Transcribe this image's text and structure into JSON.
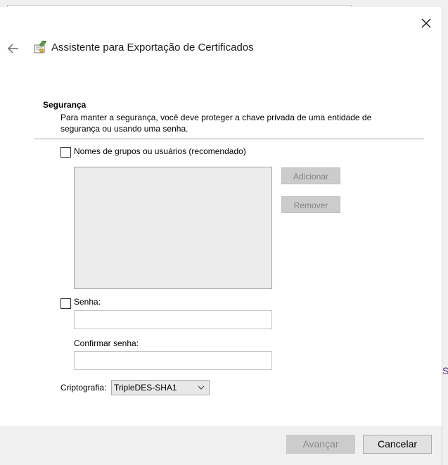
{
  "wizard": {
    "title": "Assistente para Exportação de Certificados",
    "icons": {
      "back": "back-arrow-icon",
      "close": "close-icon",
      "certificate": "certificate-wizard-icon"
    }
  },
  "section": {
    "title": "Segurança",
    "description": "Para manter a segurança, você deve proteger a chave privada de uma entidade de segurança ou usando uma senha."
  },
  "groups_option": {
    "label": "Nomes de grupos ou usuários (recomendado)",
    "checked": false,
    "list_items": [],
    "add_label": "Adicionar",
    "remove_label": "Remover"
  },
  "password_option": {
    "label": "Senha:",
    "checked": false,
    "password_value": "",
    "confirm_label": "Confirmar senha:",
    "confirm_value": ""
  },
  "encryption": {
    "label": "Criptografia:",
    "selected": "TripleDES-SHA1"
  },
  "footer": {
    "next_label": "Avançar",
    "cancel_label": "Cancelar"
  },
  "background": {
    "partial_text": "S"
  },
  "colors": {
    "disabled_button": "#cccccc",
    "footer_bg": "#f0f0f0",
    "listbox_bg": "#ececec"
  }
}
